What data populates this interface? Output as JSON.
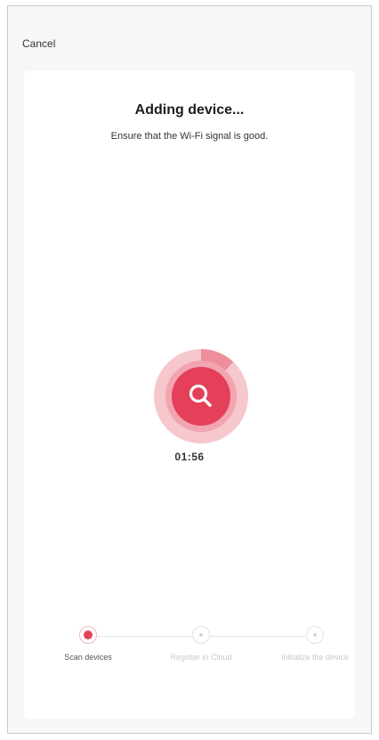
{
  "header": {
    "cancel_label": "Cancel"
  },
  "main": {
    "title": "Adding device...",
    "subtitle": "Ensure that the Wi-Fi signal is good.",
    "timer": "01:56",
    "scan_icon": "search-icon",
    "progress": 0.12
  },
  "steps": [
    {
      "label": "Scan devices",
      "state": "active"
    },
    {
      "label": "Register in Cloud",
      "state": "pending"
    },
    {
      "label": "Initialize the device",
      "state": "pending"
    }
  ],
  "colors": {
    "accent": "#e4405a",
    "ring_outer": "#f6c7cd",
    "ring_progress": "#ef8e9b",
    "inner_ring": "#f2a5b0"
  }
}
